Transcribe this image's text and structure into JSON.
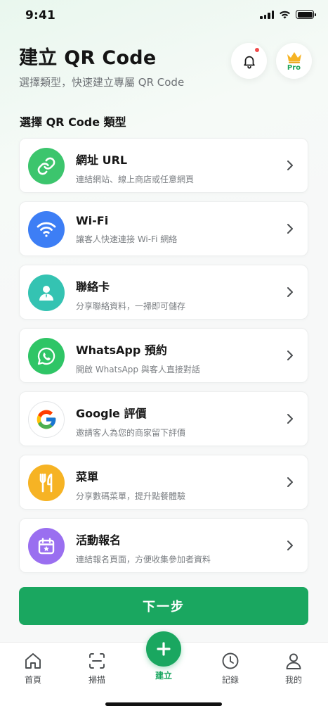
{
  "status_bar": {
    "time": "9:41"
  },
  "header": {
    "title": "建立 QR Code",
    "subtitle": "選擇類型，快速建立專屬 QR Code",
    "pro_label": "Pro"
  },
  "section_title": "選擇 QR Code 類型",
  "types": [
    {
      "name": "網址 URL",
      "desc": "連結網站、線上商店或任意網頁",
      "icon": "link-icon",
      "color": "#3cc56d"
    },
    {
      "name": "Wi-Fi",
      "desc": "讓客人快速連接 Wi-Fi 網絡",
      "icon": "wifi-icon",
      "color": "#3d7ef5"
    },
    {
      "name": "聯絡卡",
      "desc": "分享聯絡資料，一掃即可儲存",
      "icon": "contact-icon",
      "color": "#34c3b2"
    },
    {
      "name": "WhatsApp 預約",
      "desc": "開啟 WhatsApp 與客人直接對話",
      "icon": "whatsapp-icon",
      "color": "#2fc566"
    },
    {
      "name": "Google 評價",
      "desc": "邀請客人為您的商家留下評價",
      "icon": "google-icon",
      "color": "#ffffff"
    },
    {
      "name": "菜單",
      "desc": "分享數碼菜單，提升點餐體驗",
      "icon": "menu-utensils-icon",
      "color": "#f6b324"
    },
    {
      "name": "活動報名",
      "desc": "連結報名頁面，方便收集參加者資料",
      "icon": "calendar-event-icon",
      "color": "#9a6ff0"
    }
  ],
  "next_button": "下一步",
  "tab_bar": {
    "tabs": [
      {
        "label": "首頁",
        "icon": "home-icon"
      },
      {
        "label": "掃描",
        "icon": "scan-icon"
      },
      {
        "label": "建立",
        "icon": "plus-icon"
      },
      {
        "label": "記錄",
        "icon": "clock-icon"
      },
      {
        "label": "我的",
        "icon": "user-icon"
      }
    ]
  },
  "colors": {
    "brand": "#1aa760",
    "notification_dot": "#f04a4a",
    "crown": "#f6b324"
  }
}
